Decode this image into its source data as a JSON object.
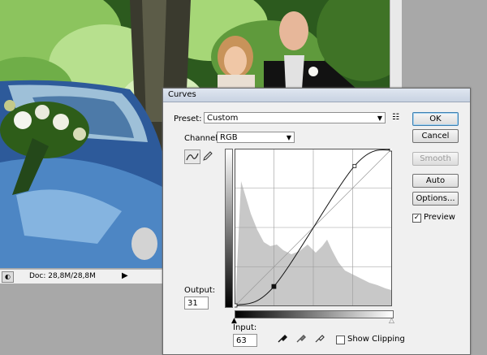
{
  "status": {
    "doc": "Doc: 28,8M/28,8M",
    "zoom_icon": "zoom-icon",
    "arrow_icon": "play-arrow-icon"
  },
  "dialog": {
    "title": "Curves",
    "preset_label": "Preset:",
    "preset_value": "Custom",
    "preset_menu_icon": "preset-options-icon",
    "channel_label": "Channel:",
    "channel_value": "RGB",
    "output_label": "Output:",
    "output_value": "31",
    "input_label": "Input:",
    "input_value": "63",
    "show_clipping_label": "Show Clipping",
    "buttons": {
      "ok": "OK",
      "cancel": "Cancel",
      "smooth": "Smooth",
      "auto": "Auto",
      "options": "Options..."
    },
    "preview_label": "Preview",
    "preview_checked": true,
    "show_clipping_checked": false
  },
  "curve": {
    "points": [
      [
        0,
        0
      ],
      [
        63,
        31
      ],
      [
        195,
        228
      ],
      [
        255,
        255
      ]
    ],
    "selected_point": [
      63,
      31
    ]
  },
  "colors": {
    "dialog_bg": "#f0f0f0",
    "default_button_border": "#3c7fb1",
    "histogram": "#c8c8c8"
  }
}
